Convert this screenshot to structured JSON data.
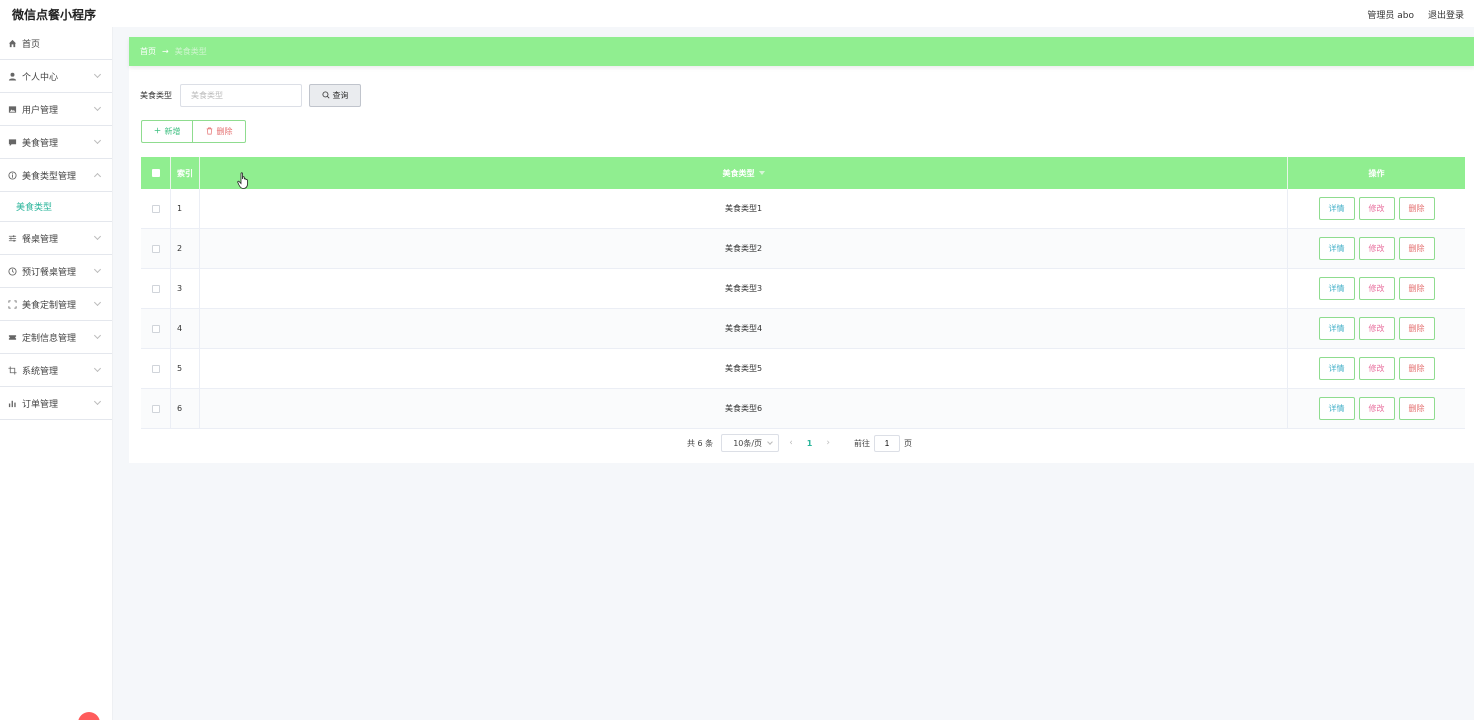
{
  "app": {
    "title": "微信点餐小程序"
  },
  "header": {
    "admin": "管理员 abo",
    "logout": "退出登录"
  },
  "sidebar": {
    "items": [
      {
        "label": "首页",
        "icon": "home-icon"
      },
      {
        "label": "个人中心",
        "icon": "user-icon"
      },
      {
        "label": "用户管理",
        "icon": "picture-icon"
      },
      {
        "label": "美食管理",
        "icon": "comment-icon"
      },
      {
        "label": "美食类型管理",
        "icon": "info-circle-icon"
      },
      {
        "label": "美食类型",
        "sub": true
      },
      {
        "label": "餐桌管理",
        "icon": "sliders-icon"
      },
      {
        "label": "预订餐桌管理",
        "icon": "clock-icon"
      },
      {
        "label": "美食定制管理",
        "icon": "fullscreen-icon"
      },
      {
        "label": "定制信息管理",
        "icon": "ticket-icon"
      },
      {
        "label": "系统管理",
        "icon": "crop-icon"
      },
      {
        "label": "订单管理",
        "icon": "bar-chart-icon"
      }
    ]
  },
  "breadcrumb": {
    "home": "首页",
    "arrow": "→",
    "current": "美食类型"
  },
  "search": {
    "label": "美食类型",
    "placeholder": "美食类型",
    "button": "查询"
  },
  "actions": {
    "add": "新增",
    "delete": "删除"
  },
  "table": {
    "headers": {
      "index": "索引",
      "type": "美食类型",
      "ops": "操作"
    },
    "rows": [
      {
        "index": "1",
        "type": "美食类型1"
      },
      {
        "index": "2",
        "type": "美食类型2"
      },
      {
        "index": "3",
        "type": "美食类型3"
      },
      {
        "index": "4",
        "type": "美食类型4"
      },
      {
        "index": "5",
        "type": "美食类型5"
      },
      {
        "index": "6",
        "type": "美食类型6"
      }
    ],
    "op_labels": {
      "detail": "详情",
      "edit": "修改",
      "delete": "删除"
    }
  },
  "pagination": {
    "total": "共 6 条",
    "page_size": "10条/页",
    "prev": "‹",
    "current": "1",
    "next": "›",
    "goto_prefix": "前往",
    "goto_value": "1",
    "goto_suffix": "页"
  },
  "colors": {
    "accent": "#90ee90",
    "active_text": "#2bb59b",
    "detail": "#45b0c9",
    "edit": "#e86f9e",
    "delete": "#e46f6f"
  }
}
